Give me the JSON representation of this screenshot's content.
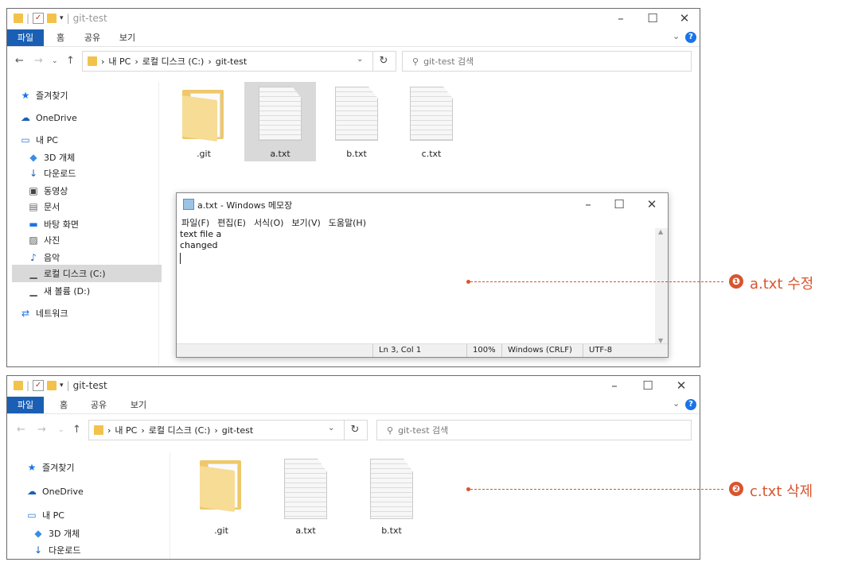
{
  "top": {
    "title": "git-test",
    "tabs": [
      "파일",
      "홈",
      "공유",
      "보기"
    ],
    "breadcrumb": [
      "내 PC",
      "로컬 디스크 (C:)",
      "git-test"
    ],
    "search_placeholder": "git-test 검색",
    "sidebar": [
      "즐겨찾기",
      "OneDrive",
      "내 PC",
      "3D 개체",
      "다운로드",
      "동영상",
      "문서",
      "바탕 화면",
      "사진",
      "음악",
      "로컬 디스크 (C:)",
      "새 볼륨 (D:)",
      "네트워크"
    ],
    "files": [
      ".git",
      "a.txt",
      "b.txt",
      "c.txt"
    ]
  },
  "notepad": {
    "title": "a.txt - Windows 메모장",
    "menu": [
      "파일(F)",
      "편집(E)",
      "서식(O)",
      "보기(V)",
      "도움말(H)"
    ],
    "text": "text file a\nchanged\n",
    "status": {
      "position": "Ln 3, Col 1",
      "zoom": "100%",
      "eol": "Windows (CRLF)",
      "encoding": "UTF-8"
    }
  },
  "bottom": {
    "title": "git-test",
    "tabs": [
      "파일",
      "홈",
      "공유",
      "보기"
    ],
    "breadcrumb": [
      "내 PC",
      "로컬 디스크 (C:)",
      "git-test"
    ],
    "search_placeholder": "git-test 검색",
    "sidebar": [
      "즐겨찾기",
      "OneDrive",
      "내 PC",
      "3D 개체",
      "다운로드"
    ],
    "files": [
      ".git",
      "a.txt",
      "b.txt"
    ]
  },
  "annotations": [
    {
      "badge": "❶",
      "text": "a.txt 수정"
    },
    {
      "badge": "❷",
      "text": "c.txt 삭제"
    }
  ],
  "colors": {
    "accent": "#1a5fb4",
    "annotation": "#d8552f",
    "selection": "#d9d9d9"
  }
}
